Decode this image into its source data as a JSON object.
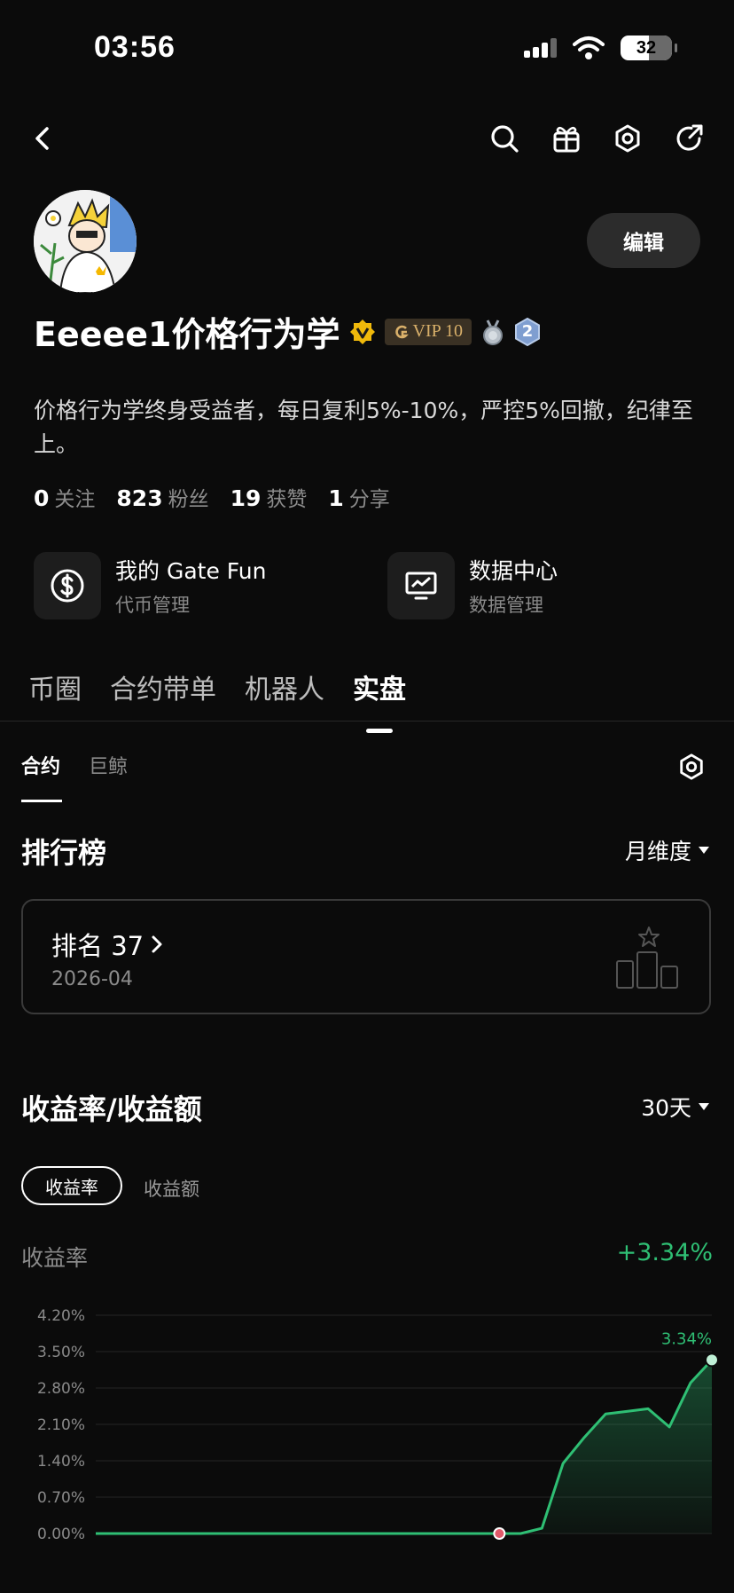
{
  "status_bar": {
    "time": "03:56",
    "battery": "32"
  },
  "profile": {
    "name": "Eeeee1价格行为学",
    "vip": "VIP 10",
    "level_badge": "2",
    "edit_label": "编辑",
    "bio": "价格行为学终身受益者，每日复利5%-10%，严控5%回撤，纪律至上。",
    "stats": [
      {
        "value": "0",
        "label": "关注"
      },
      {
        "value": "823",
        "label": "粉丝"
      },
      {
        "value": "19",
        "label": "获赞"
      },
      {
        "value": "1",
        "label": "分享"
      }
    ]
  },
  "tools": [
    {
      "title": "我的 Gate Fun",
      "subtitle": "代币管理",
      "icon": "dollar-icon"
    },
    {
      "title": "数据中心",
      "subtitle": "数据管理",
      "icon": "chart-monitor-icon"
    }
  ],
  "main_tabs": [
    "币圈",
    "合约带单",
    "机器人",
    "实盘"
  ],
  "active_main_tab": "实盘",
  "sub_tabs": [
    "合约",
    "巨鲸"
  ],
  "leaderboard": {
    "title": "排行榜",
    "period": "月维度",
    "rank_label": "排名 37",
    "date": "2026-04"
  },
  "returns": {
    "title": "收益率/收益额",
    "period": "30天",
    "pill_active": "收益率",
    "pill_inactive": "收益额",
    "metric_label": "收益率",
    "metric_value": "+3.34%"
  },
  "chart_data": {
    "type": "area",
    "yticks": [
      "4.20%",
      "3.50%",
      "2.80%",
      "2.10%",
      "1.40%",
      "0.70%",
      "0.00%"
    ],
    "ylim": [
      0,
      4.2
    ],
    "x": [
      0,
      1,
      2,
      3,
      4,
      5,
      6,
      7,
      8,
      9,
      10,
      11,
      12,
      13,
      14,
      15,
      16,
      17,
      18,
      19,
      20,
      21,
      22,
      23,
      24,
      25,
      26,
      27,
      28,
      29
    ],
    "values": [
      0,
      0,
      0,
      0,
      0,
      0,
      0,
      0,
      0,
      0,
      0,
      0,
      0,
      0,
      0,
      0,
      0,
      0,
      0,
      0,
      0,
      0.1,
      1.35,
      1.85,
      2.3,
      2.35,
      2.4,
      2.05,
      2.9,
      3.34
    ],
    "end_label": "3.34%",
    "colors": {
      "line": "#2fbf74",
      "marker": "#e05a6a"
    }
  }
}
